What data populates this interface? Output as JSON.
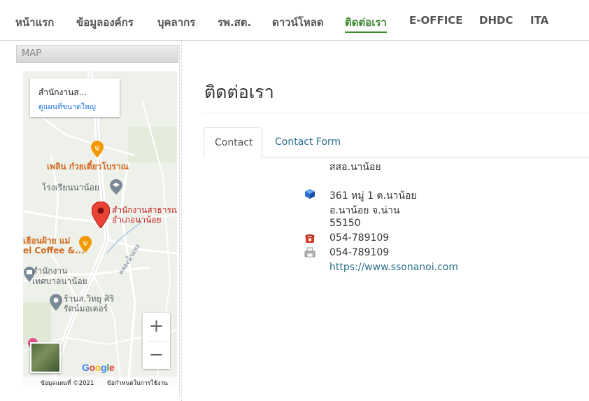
{
  "nav": [
    {
      "label": "หน้าแรก",
      "active": false
    },
    {
      "label": "ข้อมูลองค์กร",
      "active": false
    },
    {
      "label": "บุคลากร",
      "active": false
    },
    {
      "label": "รพ.สต.",
      "active": false
    },
    {
      "label": "ดาวน์โหลด",
      "active": false
    },
    {
      "label": "ติดต่อเรา",
      "active": true
    },
    {
      "label": "E-OFFICE",
      "active": false
    },
    {
      "label": "DHDC",
      "active": false
    },
    {
      "label": "ITA",
      "active": false
    }
  ],
  "sidebar": {
    "header": "MAP",
    "map": {
      "card_title": "สำนักงานส...",
      "card_link": "ดูแผนที่ขนาดใหญ่",
      "labels": {
        "restaurant": "เพลิน ก๋วยเตี๋ยวโบราณ",
        "school": "โรงเรียนนาน้อย",
        "office_line1": "สำนักงานสาธารณ",
        "office_line2": "อำเภอนาน้อย",
        "cafe_line1": "เฮือนฝ้าย แม่",
        "cafe_line2": "el Coffee &...",
        "municipal_line1": "สำนักงาน",
        "municipal_line2": "เทศบาลนาน้อย",
        "shop_line1": "ร้านส.วิทยุ ศิริ",
        "shop_line2": "รัตน์มอเตอร์",
        "road": "คลองน้ำแหง"
      },
      "zoom_in": "+",
      "zoom_out": "−",
      "logo": "Google",
      "attribution": "ข้อมูลแผนที่ ©2021",
      "terms": "ข้อกำหนดในการใช้งาน"
    }
  },
  "main": {
    "title": "ติดต่อเรา",
    "tabs": [
      {
        "label": "Contact",
        "active": true
      },
      {
        "label": "Contact Form",
        "active": false
      }
    ],
    "contact": {
      "name": "สสอ.นาน้อย",
      "address_line1": "361 หมู่ 1 ต.นาน้อย",
      "address_line2": "อ.นาน้อย จ.น่าน",
      "postcode": "55150",
      "phone": "054-789109",
      "fax": "054-789109",
      "website": "https://www.ssonanoi.com"
    }
  },
  "colors": {
    "nav_active": "#3b8a2e",
    "link": "#2a6f8e",
    "map_pin": "#ea4335",
    "map_orange": "#d2691e"
  }
}
